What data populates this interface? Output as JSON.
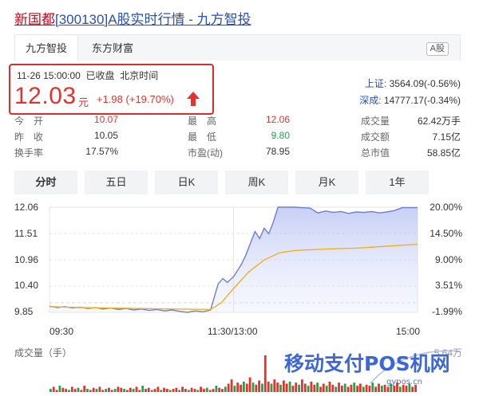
{
  "title": {
    "name": "新国都",
    "code": "[300130]",
    "rest": "A股实时行情 - 九方智投"
  },
  "tabs": [
    {
      "label": "九方智投",
      "active": true
    },
    {
      "label": "东方财富",
      "active": false
    }
  ],
  "market_badge": "A股",
  "quote": {
    "datetime": "11-26 15:00:00",
    "status": "已收盘",
    "timezone": "北京时间",
    "price": "12.03",
    "unit": "元",
    "change": "+1.98",
    "change_pct": "(+19.70%)"
  },
  "indices": [
    {
      "label": "上证:",
      "value": "3564.09(-0.56%)"
    },
    {
      "label": "深成:",
      "value": "14777.17(-0.34%)"
    }
  ],
  "stats": [
    [
      {
        "label": "今　开",
        "value": "10.07",
        "tone": "r"
      },
      {
        "label": "最　高",
        "value": "12.06",
        "tone": "r"
      },
      {
        "label": "成交量",
        "value": "62.42万手",
        "tone": ""
      }
    ],
    [
      {
        "label": "昨　收",
        "value": "10.05",
        "tone": ""
      },
      {
        "label": "最　低",
        "value": "9.80",
        "tone": "g"
      },
      {
        "label": "成交额",
        "value": "7.15亿",
        "tone": ""
      }
    ],
    [
      {
        "label": "换手率",
        "value": "17.57%",
        "tone": ""
      },
      {
        "label": "市盈(动)",
        "value": "78.95",
        "tone": ""
      },
      {
        "label": "总市值",
        "value": "58.85亿",
        "tone": ""
      }
    ]
  ],
  "chart_tabs": [
    {
      "label": "分时",
      "active": true
    },
    {
      "label": "五日",
      "active": false
    },
    {
      "label": "日K",
      "active": false
    },
    {
      "label": "周K",
      "active": false
    },
    {
      "label": "月K",
      "active": false
    },
    {
      "label": "1年",
      "active": false
    }
  ],
  "chart_data": {
    "type": "line",
    "y_left_ticks": [
      "12.06",
      "11.51",
      "10.96",
      "10.40",
      "9.85"
    ],
    "y_right_ticks": [
      "20.00%",
      "14.50%",
      "9.00%",
      "3.51%",
      "-1.99%"
    ],
    "x_ticks": [
      "09:30",
      "11:30/13:00",
      "15:00"
    ],
    "ylim": [
      9.85,
      12.06
    ],
    "prev_close": 10.05,
    "series": [
      {
        "role": "price",
        "color": "#6b7fd7",
        "points": [
          [
            0,
            9.98
          ],
          [
            5,
            9.95
          ],
          [
            10,
            9.97
          ],
          [
            15,
            9.94
          ],
          [
            20,
            9.96
          ],
          [
            25,
            9.93
          ],
          [
            30,
            9.95
          ],
          [
            35,
            9.92
          ],
          [
            40,
            9.94
          ],
          [
            45,
            9.91
          ],
          [
            50,
            9.93
          ],
          [
            55,
            9.9
          ],
          [
            60,
            9.92
          ],
          [
            65,
            9.89
          ],
          [
            70,
            9.91
          ],
          [
            75,
            9.88
          ],
          [
            80,
            9.9
          ],
          [
            85,
            9.87
          ],
          [
            90,
            9.85
          ],
          [
            95,
            9.88
          ],
          [
            100,
            9.86
          ],
          [
            105,
            9.9
          ],
          [
            110,
            10.45
          ],
          [
            113,
            10.56
          ],
          [
            116,
            10.48
          ],
          [
            120,
            10.6
          ],
          [
            125,
            10.85
          ],
          [
            128,
            11.05
          ],
          [
            131,
            11.3
          ],
          [
            134,
            11.55
          ],
          [
            137,
            11.4
          ],
          [
            140,
            11.62
          ],
          [
            143,
            11.5
          ],
          [
            146,
            11.75
          ],
          [
            149,
            12.06
          ],
          [
            160,
            12.06
          ],
          [
            170,
            12.04
          ],
          [
            175,
            11.94
          ],
          [
            180,
            11.98
          ],
          [
            185,
            11.95
          ],
          [
            190,
            11.97
          ],
          [
            195,
            11.93
          ],
          [
            200,
            11.96
          ],
          [
            205,
            11.95
          ],
          [
            210,
            11.97
          ],
          [
            215,
            11.94
          ],
          [
            220,
            11.96
          ],
          [
            225,
            11.99
          ],
          [
            230,
            12.05
          ],
          [
            240,
            12.05
          ]
        ]
      },
      {
        "role": "average",
        "color": "#f0b020",
        "points": [
          [
            0,
            9.97
          ],
          [
            20,
            9.95
          ],
          [
            40,
            9.94
          ],
          [
            60,
            9.93
          ],
          [
            80,
            9.92
          ],
          [
            105,
            9.91
          ],
          [
            112,
            10.05
          ],
          [
            120,
            10.35
          ],
          [
            130,
            10.7
          ],
          [
            140,
            10.95
          ],
          [
            150,
            11.1
          ],
          [
            160,
            11.15
          ],
          [
            180,
            11.18
          ],
          [
            200,
            11.2
          ],
          [
            220,
            11.24
          ],
          [
            240,
            11.28
          ]
        ]
      }
    ],
    "volume_title": "成交量（手）",
    "volume_max_label": "5.64万",
    "volume": [
      3,
      5,
      2,
      6,
      4,
      3,
      2,
      5,
      3,
      4,
      2,
      6,
      3,
      2,
      4,
      3,
      5,
      2,
      3,
      4,
      2,
      3,
      5,
      4,
      3,
      2,
      4,
      3,
      5,
      2,
      6,
      3,
      4,
      2,
      3,
      5,
      2,
      4,
      3,
      2,
      3,
      4,
      2,
      5,
      3,
      2,
      4,
      3,
      2,
      5,
      3,
      4,
      2,
      3,
      6,
      4,
      3,
      5,
      8,
      12,
      6,
      9,
      7,
      10,
      8,
      14,
      9,
      7,
      11,
      8,
      35,
      10,
      8,
      12,
      9,
      7,
      11,
      8,
      10,
      6,
      9,
      7,
      12,
      8,
      6,
      10,
      7,
      9,
      5,
      8,
      6,
      10,
      7,
      5,
      9,
      6,
      8,
      5,
      7,
      9,
      6,
      8,
      5,
      7,
      6,
      9,
      5,
      8,
      6,
      7,
      5,
      8,
      6,
      9,
      5,
      7,
      6,
      8,
      5,
      7
    ]
  }
}
